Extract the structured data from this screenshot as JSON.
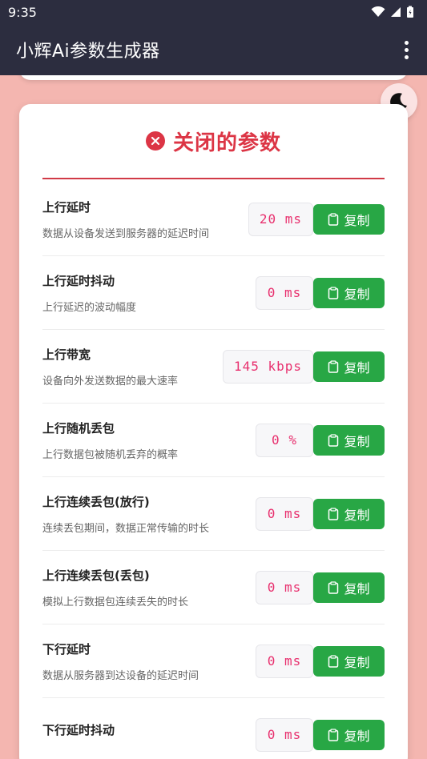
{
  "status_bar": {
    "time": "9:35"
  },
  "app_bar": {
    "title": "小辉Ai参数生成器"
  },
  "section": {
    "title": "关闭的参数"
  },
  "params": [
    {
      "name": "上行延时",
      "desc": "数据从设备发送到服务器的延迟时间",
      "value": "20 ms"
    },
    {
      "name": "上行延时抖动",
      "desc": "上行延迟的波动幅度",
      "value": "0 ms"
    },
    {
      "name": "上行带宽",
      "desc": "设备向外发送数据的最大速率",
      "value": "145 kbps"
    },
    {
      "name": "上行随机丢包",
      "desc": "上行数据包被随机丢弃的概率",
      "value": "0 %"
    },
    {
      "name": "上行连续丢包(放行)",
      "desc": "连续丢包期间，数据正常传输的时长",
      "value": "0 ms"
    },
    {
      "name": "上行连续丢包(丢包)",
      "desc": "模拟上行数据包连续丢失的时长",
      "value": "0 ms"
    },
    {
      "name": "下行延时",
      "desc": "数据从服务器到达设备的延迟时间",
      "value": "0 ms"
    },
    {
      "name": "下行延时抖动",
      "desc": "",
      "value": "0 ms"
    }
  ],
  "copy_label": "复制",
  "colors": {
    "accent_red": "#dc3545",
    "copy_green": "#28a745",
    "value_pink": "#e8306e",
    "app_bar": "#2c2d3f"
  }
}
